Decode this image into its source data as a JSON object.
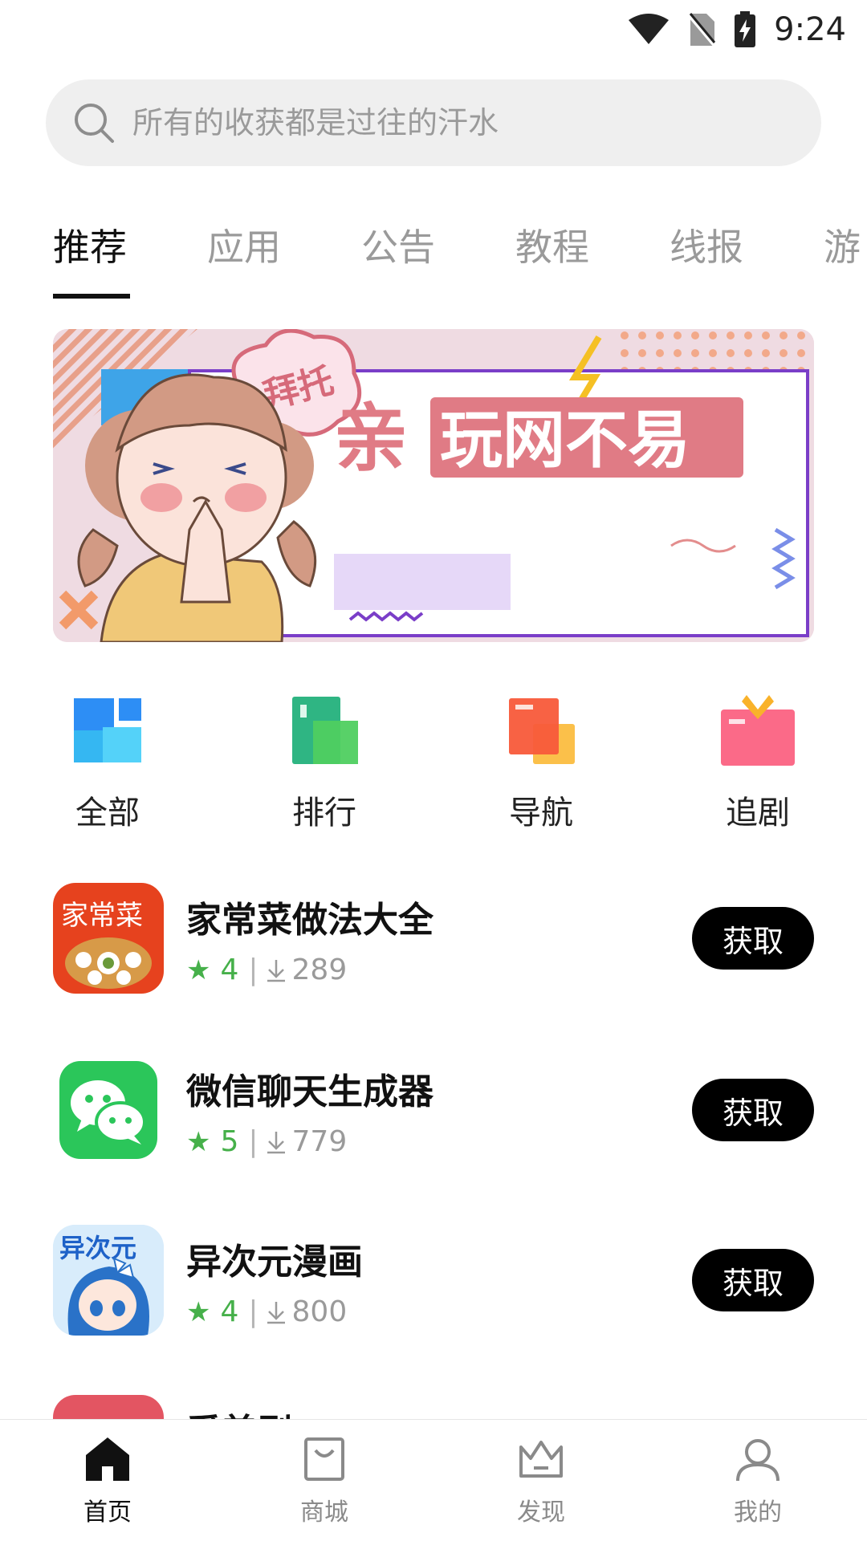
{
  "status_bar": {
    "time": "9:24",
    "icons": [
      "wifi-icon",
      "no-sim-icon",
      "battery-charging-icon"
    ]
  },
  "search": {
    "placeholder": "所有的收获都是过往的汗水"
  },
  "tabs": [
    {
      "label": "推荐",
      "active": true
    },
    {
      "label": "应用",
      "active": false
    },
    {
      "label": "公告",
      "active": false
    },
    {
      "label": "教程",
      "active": false
    },
    {
      "label": "线报",
      "active": false
    },
    {
      "label": "游",
      "active": false
    }
  ],
  "banner": {
    "bubble_text": "拜托",
    "headline_prefix": "亲",
    "headline_box": "玩网不易"
  },
  "quick_nav": [
    {
      "label": "全部",
      "icon": "grid-icon"
    },
    {
      "label": "排行",
      "icon": "ranking-icon"
    },
    {
      "label": "导航",
      "icon": "navigation-icon"
    },
    {
      "label": "追剧",
      "icon": "tv-icon"
    }
  ],
  "apps": [
    {
      "name": "家常菜做法大全",
      "rating": "4",
      "downloads": "289",
      "button": "获取",
      "icon_text": "家常菜"
    },
    {
      "name": "微信聊天生成器",
      "rating": "5",
      "downloads": "779",
      "button": "获取",
      "icon_text": ""
    },
    {
      "name": "异次元漫画",
      "rating": "4",
      "downloads": "800",
      "button": "获取",
      "icon_text": "异次元"
    },
    {
      "name": "爱美剧",
      "rating": "",
      "downloads": "",
      "button": "",
      "icon_text": ""
    }
  ],
  "bottom_nav": [
    {
      "label": "首页",
      "icon": "home-icon",
      "active": true
    },
    {
      "label": "商城",
      "icon": "shopping-bag-icon",
      "active": false
    },
    {
      "label": "发现",
      "icon": "crown-icon",
      "active": false
    },
    {
      "label": "我的",
      "icon": "user-icon",
      "active": false
    }
  ],
  "colors": {
    "accent_green": "#46b04a",
    "button_black": "#000000",
    "tab_inactive": "#9a9a9a"
  }
}
